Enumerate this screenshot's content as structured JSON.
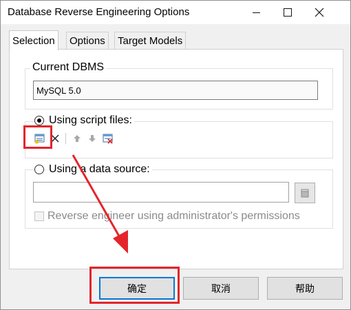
{
  "window": {
    "title": "Database Reverse Engineering Options"
  },
  "tabs": [
    {
      "label": "Selection",
      "active": true
    },
    {
      "label": "Options",
      "active": false
    },
    {
      "label": "Target Models",
      "active": false
    }
  ],
  "current_dbms": {
    "label": "Current DBMS",
    "value": "MySQL 5.0"
  },
  "script_files": {
    "label": "Using script files:",
    "selected": true,
    "toolbar": [
      "add-script-icon",
      "delete-icon",
      "move-up-icon",
      "move-down-icon",
      "clear-list-icon"
    ]
  },
  "data_source": {
    "label": "Using a data source:",
    "selected": false,
    "value": "",
    "admin_checkbox_label": "Reverse engineer using administrator's permissions",
    "admin_checked": false
  },
  "buttons": {
    "ok": "确定",
    "cancel": "取消",
    "help": "帮助"
  },
  "colors": {
    "annotation": "#e3252b",
    "focus": "#0078d7"
  }
}
